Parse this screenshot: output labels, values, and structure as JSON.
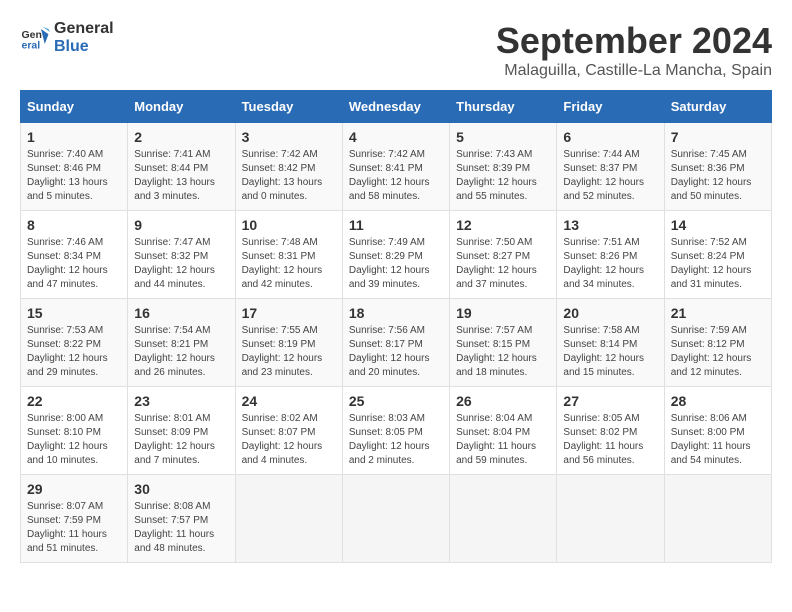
{
  "logo": {
    "text_general": "General",
    "text_blue": "Blue"
  },
  "title": "September 2024",
  "subtitle": "Malaguilla, Castille-La Mancha, Spain",
  "headers": [
    "Sunday",
    "Monday",
    "Tuesday",
    "Wednesday",
    "Thursday",
    "Friday",
    "Saturday"
  ],
  "weeks": [
    [
      {
        "day": "1",
        "sunrise": "Sunrise: 7:40 AM",
        "sunset": "Sunset: 8:46 PM",
        "daylight": "Daylight: 13 hours and 5 minutes."
      },
      {
        "day": "2",
        "sunrise": "Sunrise: 7:41 AM",
        "sunset": "Sunset: 8:44 PM",
        "daylight": "Daylight: 13 hours and 3 minutes."
      },
      {
        "day": "3",
        "sunrise": "Sunrise: 7:42 AM",
        "sunset": "Sunset: 8:42 PM",
        "daylight": "Daylight: 13 hours and 0 minutes."
      },
      {
        "day": "4",
        "sunrise": "Sunrise: 7:42 AM",
        "sunset": "Sunset: 8:41 PM",
        "daylight": "Daylight: 12 hours and 58 minutes."
      },
      {
        "day": "5",
        "sunrise": "Sunrise: 7:43 AM",
        "sunset": "Sunset: 8:39 PM",
        "daylight": "Daylight: 12 hours and 55 minutes."
      },
      {
        "day": "6",
        "sunrise": "Sunrise: 7:44 AM",
        "sunset": "Sunset: 8:37 PM",
        "daylight": "Daylight: 12 hours and 52 minutes."
      },
      {
        "day": "7",
        "sunrise": "Sunrise: 7:45 AM",
        "sunset": "Sunset: 8:36 PM",
        "daylight": "Daylight: 12 hours and 50 minutes."
      }
    ],
    [
      {
        "day": "8",
        "sunrise": "Sunrise: 7:46 AM",
        "sunset": "Sunset: 8:34 PM",
        "daylight": "Daylight: 12 hours and 47 minutes."
      },
      {
        "day": "9",
        "sunrise": "Sunrise: 7:47 AM",
        "sunset": "Sunset: 8:32 PM",
        "daylight": "Daylight: 12 hours and 44 minutes."
      },
      {
        "day": "10",
        "sunrise": "Sunrise: 7:48 AM",
        "sunset": "Sunset: 8:31 PM",
        "daylight": "Daylight: 12 hours and 42 minutes."
      },
      {
        "day": "11",
        "sunrise": "Sunrise: 7:49 AM",
        "sunset": "Sunset: 8:29 PM",
        "daylight": "Daylight: 12 hours and 39 minutes."
      },
      {
        "day": "12",
        "sunrise": "Sunrise: 7:50 AM",
        "sunset": "Sunset: 8:27 PM",
        "daylight": "Daylight: 12 hours and 37 minutes."
      },
      {
        "day": "13",
        "sunrise": "Sunrise: 7:51 AM",
        "sunset": "Sunset: 8:26 PM",
        "daylight": "Daylight: 12 hours and 34 minutes."
      },
      {
        "day": "14",
        "sunrise": "Sunrise: 7:52 AM",
        "sunset": "Sunset: 8:24 PM",
        "daylight": "Daylight: 12 hours and 31 minutes."
      }
    ],
    [
      {
        "day": "15",
        "sunrise": "Sunrise: 7:53 AM",
        "sunset": "Sunset: 8:22 PM",
        "daylight": "Daylight: 12 hours and 29 minutes."
      },
      {
        "day": "16",
        "sunrise": "Sunrise: 7:54 AM",
        "sunset": "Sunset: 8:21 PM",
        "daylight": "Daylight: 12 hours and 26 minutes."
      },
      {
        "day": "17",
        "sunrise": "Sunrise: 7:55 AM",
        "sunset": "Sunset: 8:19 PM",
        "daylight": "Daylight: 12 hours and 23 minutes."
      },
      {
        "day": "18",
        "sunrise": "Sunrise: 7:56 AM",
        "sunset": "Sunset: 8:17 PM",
        "daylight": "Daylight: 12 hours and 20 minutes."
      },
      {
        "day": "19",
        "sunrise": "Sunrise: 7:57 AM",
        "sunset": "Sunset: 8:15 PM",
        "daylight": "Daylight: 12 hours and 18 minutes."
      },
      {
        "day": "20",
        "sunrise": "Sunrise: 7:58 AM",
        "sunset": "Sunset: 8:14 PM",
        "daylight": "Daylight: 12 hours and 15 minutes."
      },
      {
        "day": "21",
        "sunrise": "Sunrise: 7:59 AM",
        "sunset": "Sunset: 8:12 PM",
        "daylight": "Daylight: 12 hours and 12 minutes."
      }
    ],
    [
      {
        "day": "22",
        "sunrise": "Sunrise: 8:00 AM",
        "sunset": "Sunset: 8:10 PM",
        "daylight": "Daylight: 12 hours and 10 minutes."
      },
      {
        "day": "23",
        "sunrise": "Sunrise: 8:01 AM",
        "sunset": "Sunset: 8:09 PM",
        "daylight": "Daylight: 12 hours and 7 minutes."
      },
      {
        "day": "24",
        "sunrise": "Sunrise: 8:02 AM",
        "sunset": "Sunset: 8:07 PM",
        "daylight": "Daylight: 12 hours and 4 minutes."
      },
      {
        "day": "25",
        "sunrise": "Sunrise: 8:03 AM",
        "sunset": "Sunset: 8:05 PM",
        "daylight": "Daylight: 12 hours and 2 minutes."
      },
      {
        "day": "26",
        "sunrise": "Sunrise: 8:04 AM",
        "sunset": "Sunset: 8:04 PM",
        "daylight": "Daylight: 11 hours and 59 minutes."
      },
      {
        "day": "27",
        "sunrise": "Sunrise: 8:05 AM",
        "sunset": "Sunset: 8:02 PM",
        "daylight": "Daylight: 11 hours and 56 minutes."
      },
      {
        "day": "28",
        "sunrise": "Sunrise: 8:06 AM",
        "sunset": "Sunset: 8:00 PM",
        "daylight": "Daylight: 11 hours and 54 minutes."
      }
    ],
    [
      {
        "day": "29",
        "sunrise": "Sunrise: 8:07 AM",
        "sunset": "Sunset: 7:59 PM",
        "daylight": "Daylight: 11 hours and 51 minutes."
      },
      {
        "day": "30",
        "sunrise": "Sunrise: 8:08 AM",
        "sunset": "Sunset: 7:57 PM",
        "daylight": "Daylight: 11 hours and 48 minutes."
      },
      null,
      null,
      null,
      null,
      null
    ]
  ]
}
